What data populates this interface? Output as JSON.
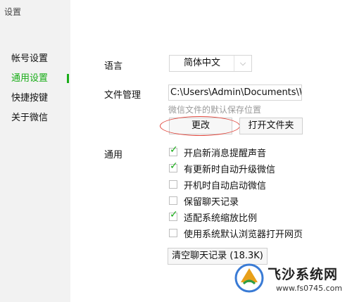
{
  "window": {
    "title": "设置"
  },
  "sidebar": {
    "items": [
      {
        "label": "帐号设置",
        "active": false
      },
      {
        "label": "通用设置",
        "active": true
      },
      {
        "label": "快捷按键",
        "active": false
      },
      {
        "label": "关于微信",
        "active": false
      }
    ]
  },
  "language": {
    "label": "语言",
    "value": "简体中文"
  },
  "file_management": {
    "label": "文件管理",
    "path": "C:\\Users\\Admin\\Documents\\W",
    "hint": "微信文件的默认保存位置",
    "change_button": "更改",
    "open_folder_button": "打开文件夹"
  },
  "general": {
    "label": "通用",
    "options": [
      {
        "label": "开启新消息提醒声音",
        "checked": true
      },
      {
        "label": "有更新时自动升级微信",
        "checked": true
      },
      {
        "label": "开机时自动启动微信",
        "checked": false
      },
      {
        "label": "保留聊天记录",
        "checked": false
      },
      {
        "label": "适配系统缩放比例",
        "checked": true
      },
      {
        "label": "使用系统默认浏览器打开网页",
        "checked": false
      }
    ],
    "clear_button": "清空聊天记录 (18.3K)"
  },
  "watermark": {
    "title": "飞沙系统网",
    "url": "www.fs0745.com"
  },
  "colors": {
    "accent": "#1aad19",
    "highlight_oval": "#e0443a"
  }
}
